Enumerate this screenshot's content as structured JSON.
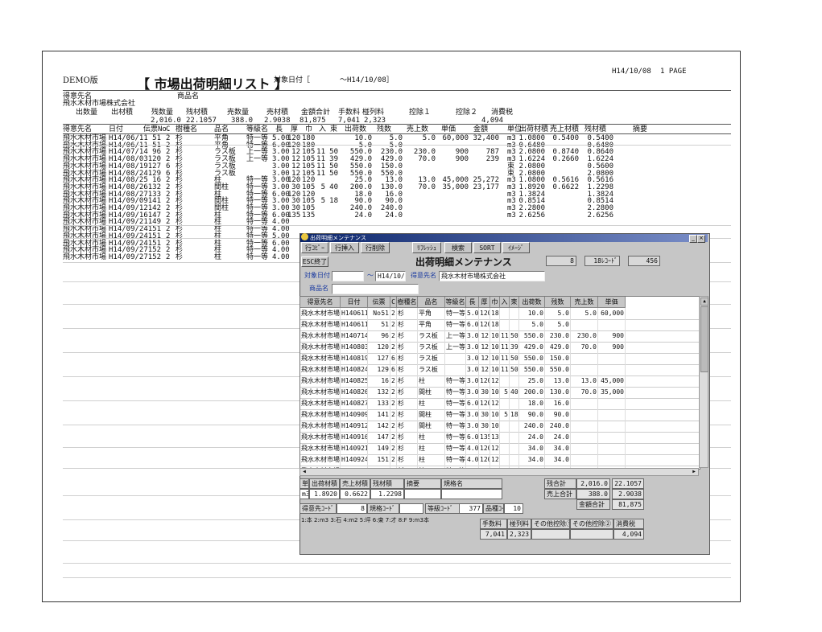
{
  "report": {
    "demo_label": "DEMO版",
    "title": "【 市場出荷明細リスト 】",
    "date_label": "対象日付［",
    "date_value": "～H14/10/08］",
    "print_date": "H14/10/08",
    "page": "1 PAGE",
    "customer_label": "得意先名",
    "product_label": "商品名",
    "customer_name": "飛水木材市場株式会社",
    "summary_headers": [
      "出数量",
      "出材積",
      "残数量",
      "残材積",
      "売数量",
      "売材積",
      "金額合計",
      "手数料",
      "椪列料",
      "控除１",
      "控除２",
      "消費税"
    ],
    "summary_values": [
      "2,016.0",
      "22.1057",
      "388.0",
      "2.9038",
      "81,875",
      "7,041",
      "2,323",
      "4,094"
    ],
    "col_headers": [
      "得意先名",
      "日付",
      "伝票No.",
      "C",
      "樹種名",
      "品名",
      "等級名",
      "長",
      "厚",
      "巾",
      "入",
      "束",
      "出荷数",
      "残数",
      "売上数",
      "単価",
      "金額",
      "単位",
      "出荷材積",
      "売上材積",
      "残材積",
      "摘要"
    ],
    "rows": [
      [
        "飛水木材市場",
        "H14/06/11",
        "51",
        "2",
        "杉",
        "平角",
        "特一等",
        "5.00",
        "120",
        "180",
        "",
        "",
        "10.0",
        "5.0",
        "5.0",
        "60,000",
        "32,400",
        "m3",
        "1.0800",
        "0.5400",
        "0.5400",
        ""
      ],
      [
        "飛水木材市場",
        "H14/06/11",
        "51",
        "2",
        "杉",
        "平角",
        "特一等",
        "6.00",
        "120",
        "180",
        "",
        "",
        "5.0",
        "5.0",
        "",
        "",
        "",
        "m3",
        "0.6480",
        "",
        "0.6480",
        ""
      ],
      [
        "飛水木材市場",
        "H14/07/14",
        "96",
        "2",
        "杉",
        "ラス板",
        "上一等",
        "3.00",
        "12",
        "105",
        "11",
        "50",
        "550.0",
        "230.0",
        "230.0",
        "900",
        "787",
        "m3",
        "2.0800",
        "0.8740",
        "0.8640",
        ""
      ],
      [
        "飛水木材市場",
        "H14/08/03",
        "120",
        "2",
        "杉",
        "ラス板",
        "上一等",
        "3.00",
        "12",
        "105",
        "11",
        "39",
        "429.0",
        "429.0",
        "70.0",
        "900",
        "239",
        "m3",
        "1.6224",
        "0.2660",
        "1.6224",
        ""
      ],
      [
        "飛水木材市場",
        "H14/08/19",
        "127",
        "6",
        "杉",
        "ラス板",
        "",
        "3.00",
        "12",
        "105",
        "11",
        "50",
        "550.0",
        "150.0",
        "",
        "",
        "",
        "束",
        "2.0800",
        "",
        "0.5600",
        ""
      ],
      [
        "飛水木材市場",
        "H14/08/24",
        "129",
        "6",
        "杉",
        "ラス板",
        "",
        "3.00",
        "12",
        "105",
        "11",
        "50",
        "550.0",
        "550.0",
        "",
        "",
        "",
        "束",
        "2.0800",
        "",
        "2.0800",
        ""
      ],
      [
        "飛水木材市場",
        "H14/08/25",
        "16",
        "2",
        "杉",
        "柱",
        "特一等",
        "3.00",
        "120",
        "120",
        "",
        "",
        "25.0",
        "13.0",
        "13.0",
        "45,000",
        "25,272",
        "m3",
        "1.0800",
        "0.5616",
        "0.5616",
        ""
      ],
      [
        "飛水木材市場",
        "H14/08/26",
        "132",
        "2",
        "杉",
        "間柱",
        "特一等",
        "3.00",
        "30",
        "105",
        "5",
        "40",
        "200.0",
        "130.0",
        "70.0",
        "35,000",
        "23,177",
        "m3",
        "1.8920",
        "0.6622",
        "1.2298",
        ""
      ],
      [
        "飛水木材市場",
        "H14/08/27",
        "133",
        "2",
        "杉",
        "柱",
        "特一等",
        "6.00",
        "120",
        "120",
        "",
        "",
        "18.0",
        "16.0",
        "",
        "",
        "",
        "m3",
        "1.3824",
        "",
        "1.3824",
        ""
      ],
      [
        "飛水木材市場",
        "H14/09/09",
        "141",
        "2",
        "杉",
        "間柱",
        "特一等",
        "3.00",
        "30",
        "105",
        "5",
        "18",
        "90.0",
        "90.0",
        "",
        "",
        "",
        "m3",
        "0.8514",
        "",
        "0.8514",
        ""
      ],
      [
        "飛水木材市場",
        "H14/09/12",
        "142",
        "2",
        "杉",
        "間柱",
        "特一等",
        "3.00",
        "30",
        "105",
        "",
        "",
        "240.0",
        "240.0",
        "",
        "",
        "",
        "m3",
        "2.2800",
        "",
        "2.2800",
        ""
      ],
      [
        "飛水木材市場",
        "H14/09/16",
        "147",
        "2",
        "杉",
        "柱",
        "特一等",
        "6.00",
        "135",
        "135",
        "",
        "",
        "24.0",
        "24.0",
        "",
        "",
        "",
        "m3",
        "2.6256",
        "",
        "2.6256",
        ""
      ],
      [
        "飛水木材市場",
        "H14/09/21",
        "149",
        "2",
        "杉",
        "柱",
        "特一等",
        "4.00",
        "",
        "",
        "",
        "",
        "",
        "",
        "",
        "",
        "",
        "",
        "",
        "",
        "",
        ""
      ],
      [
        "飛水木材市場",
        "H14/09/24",
        "151",
        "2",
        "杉",
        "柱",
        "特一等",
        "4.00",
        "",
        "",
        "",
        "",
        "",
        "",
        "",
        "",
        "",
        "",
        "",
        "",
        "",
        ""
      ],
      [
        "飛水木材市場",
        "H14/09/24",
        "151",
        "2",
        "杉",
        "柱",
        "特一等",
        "5.00",
        "",
        "",
        "",
        "",
        "",
        "",
        "",
        "",
        "",
        "",
        "",
        "",
        "",
        ""
      ],
      [
        "飛水木材市場",
        "H14/09/24",
        "151",
        "2",
        "杉",
        "柱",
        "特一等",
        "6.00",
        "",
        "",
        "",
        "",
        "",
        "",
        "",
        "",
        "",
        "",
        "",
        "",
        "",
        ""
      ],
      [
        "飛水木材市場",
        "H14/09/27",
        "152",
        "2",
        "杉",
        "柱",
        "特一等",
        "4.00",
        "",
        "",
        "",
        "",
        "",
        "",
        "",
        "",
        "",
        "",
        "",
        "",
        "",
        ""
      ],
      [
        "飛水木材市場",
        "H14/09/27",
        "152",
        "2",
        "杉",
        "柱",
        "特一等",
        "4.00",
        "",
        "",
        "",
        "",
        "",
        "",
        "",
        "",
        "",
        "",
        "",
        "",
        "",
        ""
      ]
    ]
  },
  "dialog": {
    "window_title": "出荷明細メンテナンス",
    "toolbar": [
      "行ｺﾋﾟｰ",
      "行挿入",
      "行削除",
      "ﾘﾌﾚｯｼｭ",
      "検索",
      "SORT",
      "ｲﾒｰｼﾞ"
    ],
    "esc_button": "ESC終了",
    "heading": "出荷明細メンテナンス",
    "rec_current": "8",
    "rec_total": "18ﾚｺｰﾄﾞ",
    "rec_extra": "456",
    "date_label": "対象日付",
    "date_from": "",
    "date_sep": "～",
    "date_to": "H14/10/08",
    "customer_label": "得意先名",
    "customer_value": "飛水木材市場株式会社",
    "product_label": "商品名",
    "product_value": "",
    "grid_headers": [
      "得意先名",
      "日付",
      "伝票No.",
      "C",
      "樹種名",
      "品名",
      "等級名",
      "長",
      "厚",
      "巾",
      "入",
      "束",
      "出荷数",
      "残数",
      "売上数",
      "単価"
    ],
    "grid_rows": [
      [
        "飛水木材市場",
        "H140611",
        "51",
        "2",
        "杉",
        "平角",
        "特一等",
        "5.00",
        "120",
        "180",
        "",
        "",
        "10.0",
        "5.0",
        "5.0",
        "60,000"
      ],
      [
        "飛水木材市場",
        "H140611",
        "51",
        "2",
        "杉",
        "平角",
        "特一等",
        "6.00",
        "120",
        "180",
        "",
        "",
        "5.0",
        "5.0",
        "",
        ""
      ],
      [
        "飛水木材市場",
        "H140714",
        "96",
        "2",
        "杉",
        "ラス板",
        "上一等",
        "3.00",
        "12",
        "105",
        "11",
        "50",
        "550.0",
        "230.0",
        "230.0",
        "900"
      ],
      [
        "飛水木材市場",
        "H140803",
        "120",
        "2",
        "杉",
        "ラス板",
        "上一等",
        "3.00",
        "12",
        "105",
        "11",
        "39",
        "429.0",
        "429.0",
        "70.0",
        "900"
      ],
      [
        "飛水木材市場",
        "H140819",
        "127",
        "6",
        "杉",
        "ラス板",
        "",
        "3.00",
        "12",
        "105",
        "11",
        "50",
        "550.0",
        "150.0",
        "",
        ""
      ],
      [
        "飛水木材市場",
        "H140824",
        "129",
        "6",
        "杉",
        "ラス板",
        "",
        "3.00",
        "12",
        "105",
        "11",
        "50",
        "550.0",
        "550.0",
        "",
        ""
      ],
      [
        "飛水木材市場",
        "H140825",
        "16",
        "2",
        "杉",
        "柱",
        "特一等",
        "3.00",
        "120",
        "120",
        "",
        "",
        "25.0",
        "13.0",
        "13.0",
        "45,000"
      ],
      [
        "飛水木材市場",
        "H140826",
        "132",
        "2",
        "杉",
        "間柱",
        "特一等",
        "3.00",
        "30",
        "105",
        "5",
        "40",
        "200.0",
        "130.0",
        "70.0",
        "35,000"
      ],
      [
        "飛水木材市場",
        "H140827",
        "133",
        "2",
        "杉",
        "柱",
        "特一等",
        "6.00",
        "120",
        "120",
        "",
        "",
        "18.0",
        "16.0",
        "",
        ""
      ],
      [
        "飛水木材市場",
        "H140909",
        "141",
        "2",
        "杉",
        "間柱",
        "特一等",
        "3.00",
        "30",
        "105",
        "5",
        "18",
        "90.0",
        "90.0",
        "",
        ""
      ],
      [
        "飛水木材市場",
        "H140912",
        "142",
        "2",
        "杉",
        "間柱",
        "特一等",
        "3.00",
        "30",
        "105",
        "",
        "",
        "240.0",
        "240.0",
        "",
        ""
      ],
      [
        "飛水木材市場",
        "H140916",
        "147",
        "2",
        "杉",
        "柱",
        "特一等",
        "6.00",
        "135",
        "135",
        "",
        "",
        "24.0",
        "24.0",
        "",
        ""
      ],
      [
        "飛水木材市場",
        "H140921",
        "149",
        "2",
        "杉",
        "柱",
        "特一等",
        "4.00",
        "120",
        "120",
        "",
        "",
        "34.0",
        "34.0",
        "",
        ""
      ],
      [
        "飛水木材市場",
        "H140924",
        "151",
        "2",
        "杉",
        "柱",
        "特一等",
        "4.00",
        "120",
        "120",
        "",
        "",
        "34.0",
        "34.0",
        "",
        ""
      ],
      [
        "飛水木材市場",
        "H140924",
        "151",
        "2",
        "杉",
        "柱",
        "特一等",
        "5.00",
        "105",
        "105",
        "",
        "",
        "1.0",
        "1.0",
        "",
        ""
      ]
    ],
    "detail_headers": [
      "単位",
      "出荷材積",
      "売上材積",
      "残材積",
      "摘要",
      "規格名"
    ],
    "detail_values": [
      "m3",
      "1.8920",
      "0.6622",
      "1.2298",
      "",
      ""
    ],
    "total_label": "残合計",
    "total_qty": "2,016.0",
    "total_vol": "22.1057",
    "sales_total_label": "売上合計",
    "sales_qty": "388.0",
    "sales_vol": "2.9038",
    "amount_label": "金額合計",
    "amount_value": "81,875",
    "cat_labels": [
      "得意先ｺｰﾄﾞ",
      "規格ｺｰﾄﾞ",
      "等級ｺｰﾄﾞ",
      "品種ｺｰﾄﾞ"
    ],
    "cat_values": [
      "8",
      "",
      "377",
      "10"
    ],
    "unit_hint": "1:本 2:m3 3:石 4:m2 5:坪 6:束 7:才 8:F 9:m3本",
    "fee_headers": [
      "手数料",
      "椪列料",
      "その他控除①",
      "その他控除②",
      "消費税"
    ],
    "fee_values": [
      "7,041",
      "2,323",
      "",
      "",
      "4,094"
    ]
  }
}
